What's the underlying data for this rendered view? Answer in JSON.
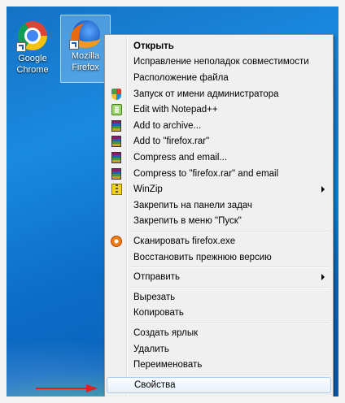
{
  "desktop": {
    "icons": [
      {
        "label_line1": "Google",
        "label_line2": "Chrome"
      },
      {
        "label_line1": "Mozilla",
        "label_line2": "Firefox"
      }
    ]
  },
  "menu": {
    "items": [
      {
        "label": "Открыть",
        "bold": true,
        "icon": null
      },
      {
        "label": "Исправление неполадок совместимости",
        "icon": null
      },
      {
        "label": "Расположение файла",
        "icon": null
      },
      {
        "label": "Запуск от имени администратора",
        "icon": "uac-shield-icon"
      },
      {
        "label": "Edit with Notepad++",
        "icon": "notepad-plus-plus-icon"
      },
      {
        "label": "Add to archive...",
        "icon": "winrar-icon"
      },
      {
        "label": "Add to \"firefox.rar\"",
        "icon": "winrar-icon"
      },
      {
        "label": "Compress and email...",
        "icon": "winrar-icon"
      },
      {
        "label": "Compress to \"firefox.rar\" and email",
        "icon": "winrar-icon"
      },
      {
        "label": "WinZip",
        "icon": "winzip-icon",
        "submenu": true
      },
      {
        "label": "Закрепить на панели задач",
        "icon": null
      },
      {
        "label": "Закрепить в меню \"Пуск\"",
        "icon": null
      },
      {
        "label": "Сканировать firefox.exe",
        "icon": "antivirus-scan-icon"
      },
      {
        "label": "Восстановить прежнюю версию",
        "icon": null
      },
      {
        "label": "Отправить",
        "icon": null,
        "submenu": true
      },
      {
        "label": "Вырезать",
        "icon": null
      },
      {
        "label": "Копировать",
        "icon": null
      },
      {
        "label": "Создать ярлык",
        "icon": null
      },
      {
        "label": "Удалить",
        "icon": null
      },
      {
        "label": "Переименовать",
        "icon": null
      },
      {
        "label": "Свойства",
        "icon": null,
        "highlighted": true
      }
    ]
  },
  "colors": {
    "menu_bg": "#f0f0f0",
    "highlight_border": "#a8cbf1",
    "arrow": "#e0201a"
  }
}
